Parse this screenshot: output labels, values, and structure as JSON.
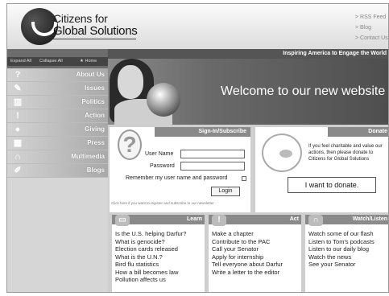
{
  "brand": {
    "line1": "Citizens for",
    "line2": "Global Solutions"
  },
  "top_links": [
    "> RSS Feed",
    "> Blog",
    "> Contact Us"
  ],
  "left_header": {
    "expand_all": "Expand All",
    "collapse_all": "Collapse All",
    "home": "Home"
  },
  "tagline": "Inspiring America to Engage the World",
  "welcome": "Welcome to our new website",
  "nav": [
    {
      "label": "About Us",
      "icon": "question-icon"
    },
    {
      "label": "Issues",
      "icon": "pencil-icon"
    },
    {
      "label": "Politics",
      "icon": "capitol-icon"
    },
    {
      "label": "Action",
      "icon": "exclamation-icon"
    },
    {
      "label": "Giving",
      "icon": "hand-coin-icon"
    },
    {
      "label": "Press",
      "icon": "building-icon"
    },
    {
      "label": "Multimedia",
      "icon": "headphones-icon"
    },
    {
      "label": "Blogs",
      "icon": "blog-pen-icon"
    }
  ],
  "signin": {
    "title": "Sign-In/Subscribe",
    "username_label": "User Name",
    "password_label": "Password",
    "remember_label": "Remember my user name and password",
    "login_button": "Login",
    "register_note": "Click here if you want to register and subscribe to our newsletter."
  },
  "donate": {
    "title": "Donate",
    "text": "If you feel charitable and value our actions, then please donate to Citizens for Global Solutions",
    "button": "I want to donate."
  },
  "learn": {
    "title": "Learn",
    "items": [
      "Is the U.S. helping Darfur?",
      "What is genocide?",
      "Election cards released",
      "What is the U.N.?",
      "Bird flu statistics",
      "How a bill becomes law",
      "Pollution affects us"
    ]
  },
  "act": {
    "title": "Act",
    "items": [
      "Make a chapter",
      "Contribute to the PAC",
      "Call your Senator",
      "Apply for internship",
      "Tell everyone about Darfur",
      "Write a letter to the editor"
    ]
  },
  "watch": {
    "title": "Watch/Listen",
    "items": [
      "Watch some of our flash",
      "Listen to Tom's podcasts",
      "Listen to our daily blog",
      "Watch the news",
      "See your Senator"
    ]
  }
}
